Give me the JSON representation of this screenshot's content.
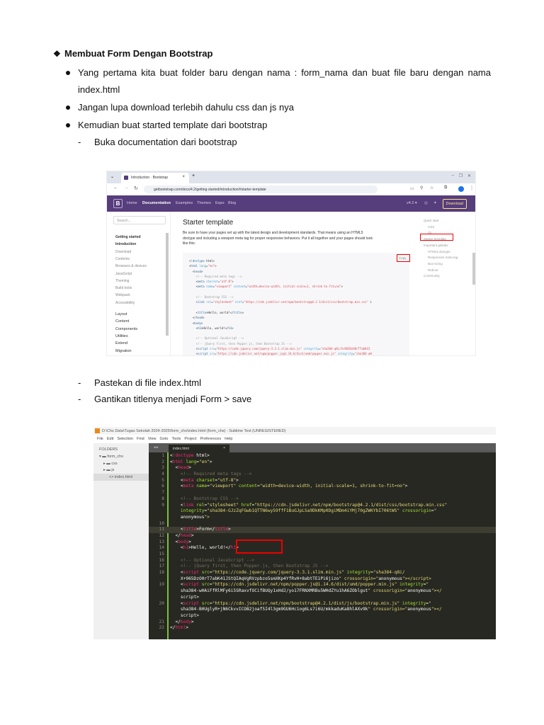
{
  "doc": {
    "heading": "Membuat Form Dengan Bootstrap",
    "bullets": [
      "Yang pertama kita buat folder baru dengan nama : form_nama dan buat file baru dengan nama index.html",
      "Jangan lupa download terlebih dahulu css dan js nya",
      "Kemudian buat started template dari bootstrap"
    ],
    "dash_items": [
      "Buka documentation dari bootstrap",
      "Pastekan di file index.html",
      "Gantikan titlenya menjadi Form > save"
    ]
  },
  "browser": {
    "tab_title": "Introduction · Bootstrap",
    "url": "getbootstrap.com/docs/4.2/getting-started/introduction/#starter-template",
    "brand": "B",
    "nav": [
      "Home",
      "Documentation",
      "Examples",
      "Themes",
      "Expo",
      "Blog"
    ],
    "version": "v4.2 ▾",
    "download": "Download",
    "search_placeholder": "Search...",
    "sidebar": [
      "Getting started",
      "Introduction",
      "Download",
      "Contents",
      "Browsers & devices",
      "JavaScript",
      "Theming",
      "Build tools",
      "Webpack",
      "Accessibility",
      "Layout",
      "Content",
      "Components",
      "Utilities",
      "Extend",
      "Migration"
    ],
    "page_title": "Starter template",
    "intro": "Be sure to have your pages set up with the latest design and development standards. That means using an HTML5 doctype and including a viewport meta tag for proper responsive behaviors. Put it all together and your pages should look like this:",
    "copy": "Copy",
    "code": [
      "<!doctype html>",
      "<html lang=\"en\">",
      "  <head>",
      "    <!-- Required meta tags -->",
      "    <meta charset=\"utf-8\">",
      "    <meta name=\"viewport\" content=\"width=device-width, initial-scale=1, shrink-to-fit=no\">",
      "",
      "    <!-- Bootstrap CSS -->",
      "    <link rel=\"stylesheet\" href=\"https://cdn.jsdelivr.net/npm/bootstrap@4.2.1/dist/css/bootstrap.min.css\" i",
      "",
      "    <title>Hello, world!</title>",
      "  </head>",
      "  <body>",
      "    <h1>Hello, world!</h1>",
      "",
      "    <!-- Optional JavaScript -->",
      "    <!-- jQuery first, then Popper.js, then Bootstrap JS -->",
      "    <script src=\"https://code.jquery.com/jquery-3.3.1.slim.min.js\" integrity=\"sha384-q8i/X+965DzO0rT7abK41",
      "    <script src=\"https://cdn.jsdelivr.net/npm/popper.js@1.14.6/dist/umd/popper.min.js\" integrity=\"sha384-wH"
    ],
    "toc": [
      "Quick start",
      "CSS",
      "JS",
      "Starter template",
      "Important globals",
      "HTML5 doctype",
      "Responsive meta tag",
      "Box-sizing",
      "Reboot",
      "Community"
    ]
  },
  "sublime": {
    "title": "D:\\Chs Data\\Tugas Sekolah 2024-2025\\form_chs\\index.html (form_chs) - Sublime Text (UNREGISTERED)",
    "menu": [
      "File",
      "Edit",
      "Selection",
      "Find",
      "View",
      "Goto",
      "Tools",
      "Project",
      "Preferences",
      "Help"
    ],
    "folders_label": "FOLDERS",
    "tree": [
      "form_chs",
      "css",
      "js",
      "index.html"
    ],
    "tab": "index.html",
    "rows": [
      {
        "n": "1",
        "t": "<!doctype html>"
      },
      {
        "n": "2",
        "t": "<html lang=\"en\">"
      },
      {
        "n": "3",
        "t": "  <head>"
      },
      {
        "n": "4",
        "t": "    <!-- Required meta tags -->"
      },
      {
        "n": "5",
        "t": "    <meta charset=\"utf-8\">"
      },
      {
        "n": "6",
        "t": "    <meta name=\"viewport\" content=\"width=device-width, initial-scale=1, shrink-to-fit=no\">"
      },
      {
        "n": "7",
        "t": ""
      },
      {
        "n": "8",
        "t": "    <!-- Bootstrap CSS -->"
      },
      {
        "n": "9",
        "t": "    <link rel=\"stylesheet\" href=\"https://cdn.jsdelivr.net/npm/bootstrap@4.2.1/dist/css/bootstrap.min.css\""
      },
      {
        "n": "",
        "t": "    integrity=\"sha384-GJzZqFGwb1QTTN6wy59ffF1BuGJpLSa9DkKMp0DgiMDm4iYMj70gZWKYbI706tWS\" crossorigin=\""
      },
      {
        "n": "",
        "t": "    anonymous\">"
      },
      {
        "n": "10",
        "t": ""
      },
      {
        "n": "11",
        "t": "    <title>Form</title>"
      },
      {
        "n": "12",
        "t": "  </head>"
      },
      {
        "n": "13",
        "t": "  <body>"
      },
      {
        "n": "14",
        "t": "    <h1>Hello, world!</h1>"
      },
      {
        "n": "15",
        "t": ""
      },
      {
        "n": "16",
        "t": "    <!-- Optional JavaScript -->"
      },
      {
        "n": "17",
        "t": "    <!-- jQuery first, then Popper.js, then Bootstrap JS -->"
      },
      {
        "n": "18",
        "t": "    <script src=\"https://code.jquery.com/jquery-3.3.1.slim.min.js\" integrity=\"sha384-q8i/"
      },
      {
        "n": "",
        "t": "    X+965DzO0rT7abK41JStQIAqVgRVzpbzo5smXKp4YfRvH+8abtTE1Pi6jizo\" crossorigin=\"anonymous\"></script>"
      },
      {
        "n": "19",
        "t": "    <script src=\"https://cdn.jsdelivr.net/npm/popper.js@1.14.6/dist/umd/popper.min.js\" integrity=\""
      },
      {
        "n": "",
        "t": "    sha384-wHAiFfRlMFy6i5SRaxvfOCifBUQy1xHdJ/yo17FRNXMRBu5WHdZYu1hA6ZOblgut\" crossorigin=\"anonymous\"></"
      },
      {
        "n": "",
        "t": "    script>"
      },
      {
        "n": "20",
        "t": "    <script src=\"https://cdn.jsdelivr.net/npm/bootstrap@4.2.1/dist/js/bootstrap.min.js\" integrity=\""
      },
      {
        "n": "",
        "t": "    sha384-B0UglyR+jN6CkvvICOB2joaf5I4l3gm9GU6Hc1og6Ls7i6U/mkkaduKa8hlAXv9k\" crossorigin=\"anonymous\"></"
      },
      {
        "n": "",
        "t": "    script>"
      },
      {
        "n": "21",
        "t": "  </body>"
      },
      {
        "n": "22",
        "t": "</html>"
      }
    ],
    "highlight_line": "11"
  }
}
